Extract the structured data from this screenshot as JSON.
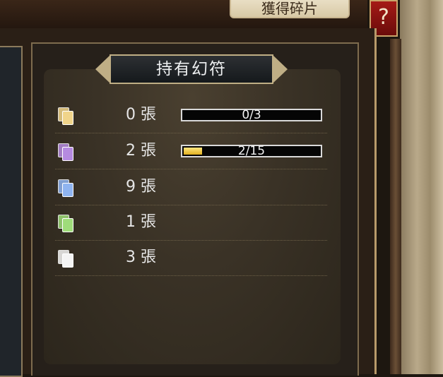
{
  "header": {
    "top_button_label": "獲得碎片",
    "help_label": "?"
  },
  "panel": {
    "title": "持有幻符",
    "rows": [
      {
        "icon": "yellow-card-icon",
        "color": "#f0d48a",
        "count": "0 張",
        "progress_text": "0/3",
        "progress": 0.0
      },
      {
        "icon": "purple-card-icon",
        "color": "#b58ae0",
        "count": "2 張",
        "progress_text": "2/15",
        "progress": 0.133
      },
      {
        "icon": "blue-card-icon",
        "color": "#8fb4f0",
        "count": "9 張"
      },
      {
        "icon": "green-card-icon",
        "color": "#9fdc7a",
        "count": "1 張"
      },
      {
        "icon": "white-card-icon",
        "color": "#f4f4f4",
        "count": "3 張"
      }
    ]
  }
}
